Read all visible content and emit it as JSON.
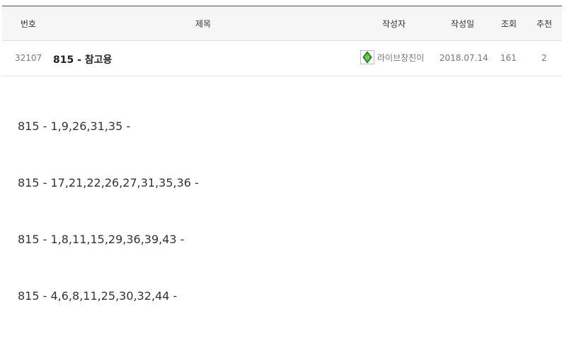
{
  "table_header": {
    "number": "번호",
    "title": "제목",
    "author": "작성자",
    "date": "작성일",
    "views": "조회",
    "recommend": "추천"
  },
  "post": {
    "number": "32107",
    "title": "815 - 참고용",
    "author": "라이브창진이",
    "author_icon": "green-gem-level-icon",
    "date": "2018.07.14",
    "views": "161",
    "recommend": "2"
  },
  "content": {
    "lines": [
      "815 - 1,9,26,31,35 -",
      "815 - 17,21,22,26,27,31,35,36 -",
      "815 - 1,8,11,15,29,36,39,43 -",
      "815 - 4,6,8,11,25,30,32,44 -"
    ]
  },
  "colors": {
    "header_border": "#3f4f6b",
    "header_bg": "#f6f6f6",
    "gem_green": "#3aa52e"
  }
}
